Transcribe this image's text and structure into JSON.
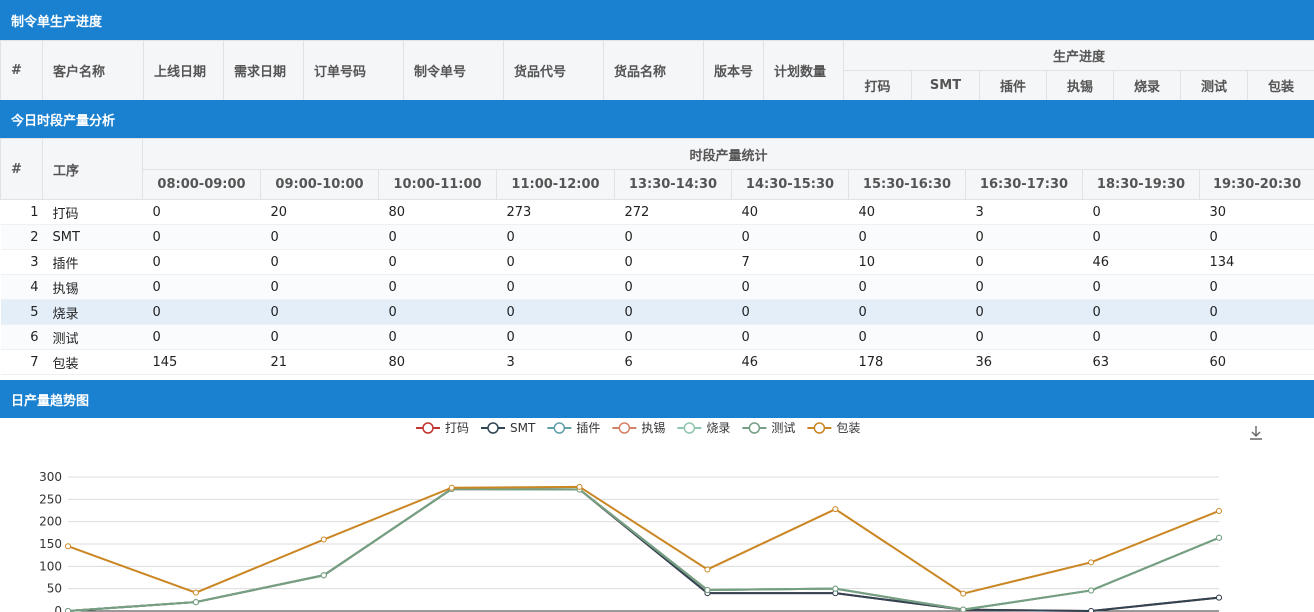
{
  "orders": {
    "title": "制令单生产进度",
    "columns": [
      "#",
      "客户名称",
      "上线日期",
      "需求日期",
      "订单号码",
      "制令单号",
      "货品代号",
      "货品名称",
      "版本号",
      "计划数量"
    ],
    "progress_header": "生产进度",
    "progress_columns": [
      "打码",
      "SMT",
      "插件",
      "执锡",
      "烧录",
      "测试",
      "包装"
    ]
  },
  "hourly": {
    "title": "今日时段产量分析",
    "col_index": "#",
    "col_process": "工序",
    "group_header": "时段产量统计",
    "slots": [
      "08:00-09:00",
      "09:00-10:00",
      "10:00-11:00",
      "11:00-12:00",
      "13:30-14:30",
      "14:30-15:30",
      "15:30-16:30",
      "16:30-17:30",
      "18:30-19:30",
      "19:30-20:30"
    ],
    "rows": [
      {
        "idx": "1",
        "process": "打码",
        "values": [
          "0",
          "20",
          "80",
          "273",
          "272",
          "40",
          "40",
          "3",
          "0",
          "30"
        ]
      },
      {
        "idx": "2",
        "process": "SMT",
        "values": [
          "0",
          "0",
          "0",
          "0",
          "0",
          "0",
          "0",
          "0",
          "0",
          "0"
        ]
      },
      {
        "idx": "3",
        "process": "插件",
        "values": [
          "0",
          "0",
          "0",
          "0",
          "0",
          "7",
          "10",
          "0",
          "46",
          "134"
        ]
      },
      {
        "idx": "4",
        "process": "执锡",
        "values": [
          "0",
          "0",
          "0",
          "0",
          "0",
          "0",
          "0",
          "0",
          "0",
          "0"
        ]
      },
      {
        "idx": "5",
        "process": "烧录",
        "values": [
          "0",
          "0",
          "0",
          "0",
          "0",
          "0",
          "0",
          "0",
          "0",
          "0"
        ]
      },
      {
        "idx": "6",
        "process": "测试",
        "values": [
          "0",
          "0",
          "0",
          "0",
          "0",
          "0",
          "0",
          "0",
          "0",
          "0"
        ]
      },
      {
        "idx": "7",
        "process": "包装",
        "values": [
          "145",
          "21",
          "80",
          "3",
          "6",
          "46",
          "178",
          "36",
          "63",
          "60"
        ]
      }
    ]
  },
  "trend": {
    "title": "日产量趋势图",
    "download_icon": "download-icon"
  },
  "chart_data": {
    "type": "line",
    "title": "",
    "xlabel": "",
    "ylabel": "",
    "ylim": [
      0,
      300
    ],
    "yticks": [
      0,
      50,
      100,
      150,
      200,
      250,
      300
    ],
    "grid": true,
    "legend_position": "top-center",
    "x": [
      1,
      2,
      3,
      4,
      5,
      6,
      7,
      8,
      9,
      10
    ],
    "series": [
      {
        "name": "打码",
        "color": "#c23531",
        "values": [
          0,
          20,
          80,
          273,
          272,
          40,
          40,
          3,
          0,
          30
        ]
      },
      {
        "name": "SMT",
        "color": "#2f4554",
        "values": [
          0,
          20,
          80,
          273,
          272,
          40,
          40,
          3,
          0,
          30
        ]
      },
      {
        "name": "插件",
        "color": "#61a0a8",
        "values": [
          0,
          20,
          80,
          273,
          272,
          47,
          50,
          3,
          46,
          164
        ]
      },
      {
        "name": "执锡",
        "color": "#d48265",
        "values": [
          0,
          20,
          80,
          273,
          272,
          47,
          50,
          3,
          46,
          164
        ]
      },
      {
        "name": "烧录",
        "color": "#91c7ae",
        "values": [
          0,
          20,
          80,
          273,
          272,
          47,
          50,
          3,
          46,
          164
        ]
      },
      {
        "name": "测试",
        "color": "#749f83",
        "values": [
          0,
          20,
          80,
          273,
          272,
          47,
          50,
          3,
          46,
          164
        ]
      },
      {
        "name": "包装",
        "color": "#ca8622",
        "values": [
          145,
          41,
          160,
          276,
          278,
          93,
          228,
          39,
          109,
          224
        ]
      }
    ]
  }
}
